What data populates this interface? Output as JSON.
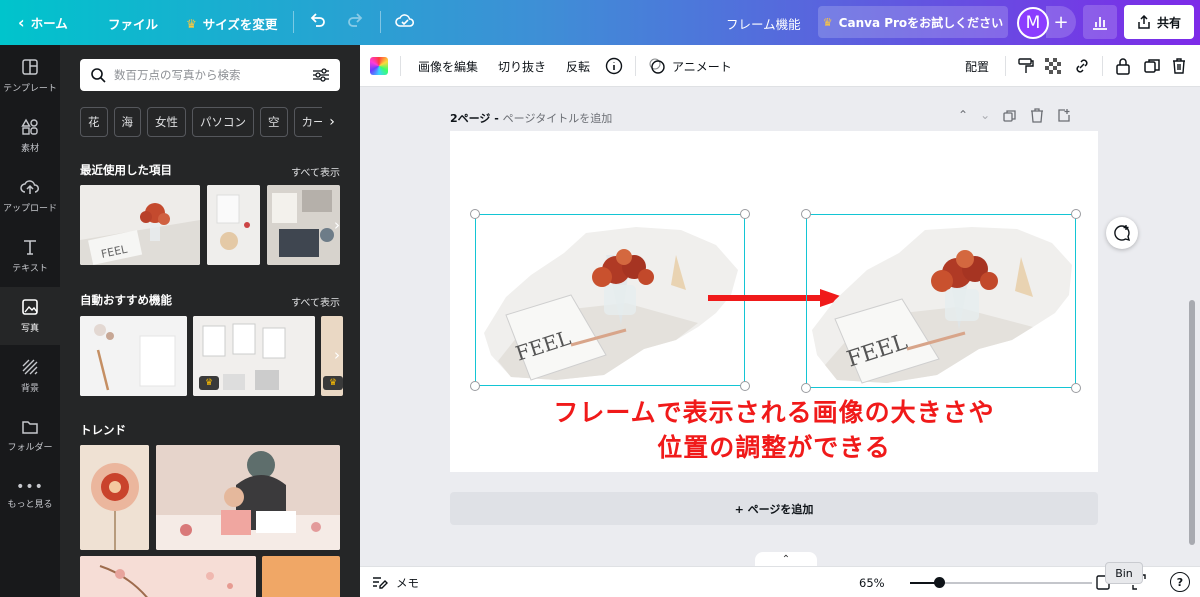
{
  "topbar": {
    "home_label": "ホーム",
    "file_label": "ファイル",
    "resize_label": "サイズを変更",
    "frame_feature_label": "フレーム機能",
    "canva_pro_label": "Canva Proをお試しください",
    "avatar_initial": "M",
    "share_label": "共有"
  },
  "leftnav": {
    "items": [
      {
        "label": "テンプレート",
        "icon": "template-icon"
      },
      {
        "label": "素材",
        "icon": "elements-icon"
      },
      {
        "label": "アップロード",
        "icon": "upload-icon"
      },
      {
        "label": "テキスト",
        "icon": "text-icon"
      },
      {
        "label": "写真",
        "icon": "photo-icon"
      },
      {
        "label": "背景",
        "icon": "background-icon"
      },
      {
        "label": "フォルダー",
        "icon": "folder-icon"
      },
      {
        "label": "もっと見る",
        "icon": "more-icon"
      }
    ],
    "active": "写真"
  },
  "panel": {
    "search_placeholder": "数百万点の写真から検索",
    "chips": [
      "花",
      "海",
      "女性",
      "パソコン",
      "空",
      "カーネーション"
    ],
    "recent_title": "最近使用した項目",
    "recent_all": "すべて表示",
    "auto_title": "自動おすすめ機能",
    "auto_all": "すべて表示",
    "trend_title": "トレンド"
  },
  "toolbar": {
    "edit_image": "画像を編集",
    "crop": "切り抜き",
    "flip": "反転",
    "animate": "アニメート",
    "position": "配置"
  },
  "canvas": {
    "page_label_bold": "2ページ - ",
    "page_label_muted": "ページタイトルを追加",
    "caption_line1": "フレームで表示される画像の大きさや",
    "caption_line2": "位置の調整ができる",
    "add_page": "+ ページを追加",
    "accent_color": "#13c5d4",
    "arrow_color": "#f01a1a"
  },
  "bottombar": {
    "memo_label": "メモ",
    "zoom": "65%",
    "zoom_fraction": 0.16,
    "tooltip": "Bin",
    "help": "?"
  }
}
